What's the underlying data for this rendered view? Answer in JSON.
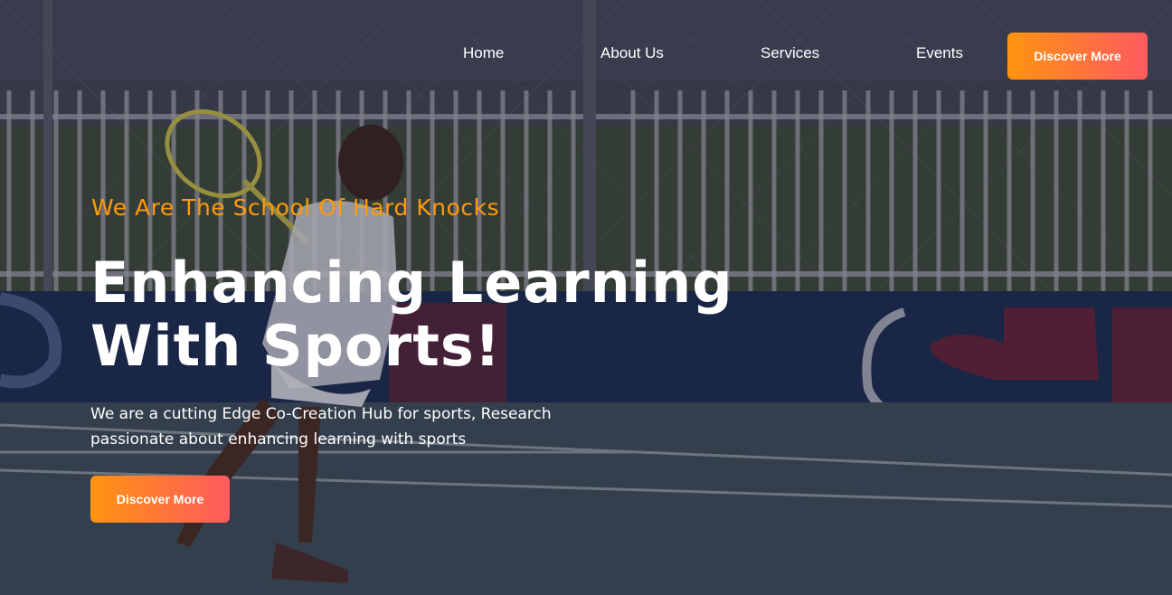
{
  "nav": {
    "links": [
      "Home",
      "About Us",
      "Services",
      "Events"
    ],
    "cta_label": "Discover More"
  },
  "hero": {
    "tagline": "We Are The School Of Hard Knocks",
    "headline_line1": "Enhancing Learning",
    "headline_line2": "With Sports!",
    "description_line1": "We are a cutting Edge Co-Creation Hub for sports, Research",
    "description_line2": "passionate about enhancing learning with sports",
    "cta_label": "Discover More"
  },
  "colors": {
    "accent_orange": "#ff9a0c",
    "gradient_start": "#ff9410",
    "gradient_end": "#ff5a5f",
    "text_white": "#ffffff"
  },
  "background": {
    "icon": "tennis-player-photo"
  }
}
